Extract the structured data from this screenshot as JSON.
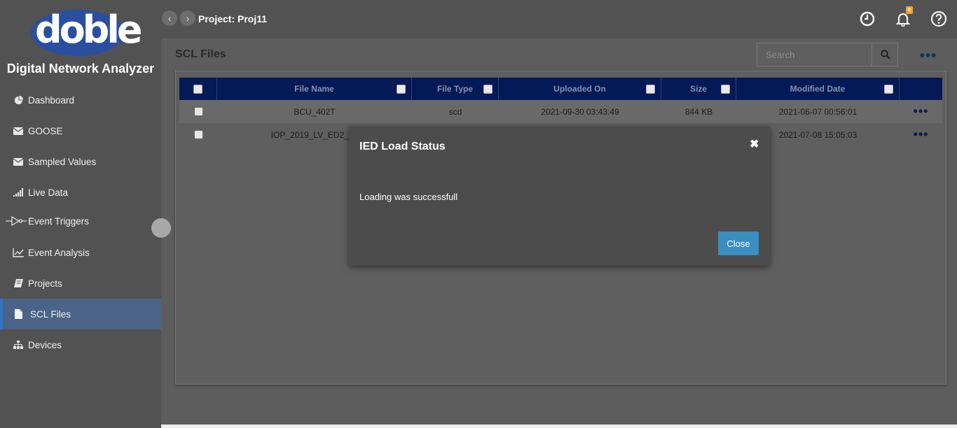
{
  "app": {
    "logo_text": "doble",
    "logo_mark": "®",
    "title": "Digital Network Analyzer"
  },
  "sidebar": {
    "items": [
      {
        "label": "Dashboard",
        "icon": "pie-chart-icon"
      },
      {
        "label": "GOOSE",
        "icon": "envelope-icon"
      },
      {
        "label": "Sampled Values",
        "icon": "envelope-icon"
      },
      {
        "label": "Live Data",
        "icon": "signal-bars-icon"
      },
      {
        "label": "Event Triggers",
        "icon": "trigger-gate-icon"
      },
      {
        "label": "Event Analysis",
        "icon": "line-chart-icon"
      },
      {
        "label": "Projects",
        "icon": "book-icon"
      },
      {
        "label": "SCL Files",
        "icon": "file-icon",
        "active": true
      },
      {
        "label": "Devices",
        "icon": "sitemap-icon"
      }
    ]
  },
  "header": {
    "project_title": "Project: Proj11",
    "back_glyph": "‹",
    "forward_glyph": "›",
    "notification_count": "8"
  },
  "page": {
    "title": "SCL Files",
    "search_placeholder": "Search",
    "more_glyph": "•••"
  },
  "table": {
    "columns": [
      "File Name",
      "File Type",
      "Uploaded On",
      "Size",
      "Modified Date"
    ],
    "rows": [
      {
        "file_name": "BCU_402T",
        "file_type": "scd",
        "uploaded_on": "2021-09-30 03:43:49",
        "size": "844 KB",
        "modified_date": "2021-06-07 00:56:01"
      },
      {
        "file_name": "IOP_2019_LV_ED2_0_",
        "file_type": "",
        "uploaded_on": "",
        "size": "",
        "modified_date": "2021-07-08 15:05:03"
      }
    ],
    "row_more_glyph": "•••"
  },
  "modal": {
    "title": "IED Load Status",
    "close_glyph": "✖",
    "message": "Loading was successfull",
    "button_label": "Close"
  },
  "colors": {
    "sidebar_bg": "#525252",
    "active_item_bg": "#4a6387",
    "table_header_bg": "#031a57",
    "primary_button": "#3a8ec2",
    "badge": "#f0a030"
  }
}
